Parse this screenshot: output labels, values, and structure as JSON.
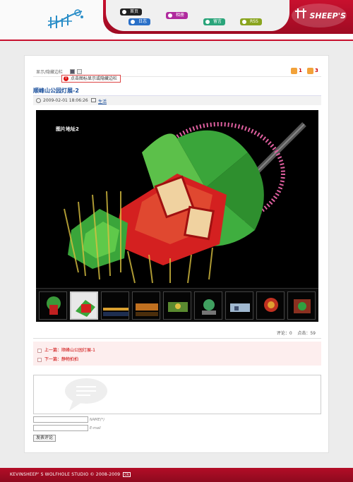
{
  "header": {
    "brand": "SHEEP'S",
    "nav": [
      {
        "label": "首页"
      },
      {
        "label": "日志"
      },
      {
        "label": "相册"
      },
      {
        "label": "留言"
      },
      {
        "label": "RSS"
      }
    ]
  },
  "toolbar": {
    "toggle_label": "显示/隐藏边栏",
    "tooltip": "点击图标显示或隐藏边栏",
    "stat1": "1",
    "stat2": "3"
  },
  "post": {
    "title": "顺峰山公园灯展-2",
    "datetime": "2009-02-01 18:06:26",
    "category": "生活",
    "photo_caption": "图片地址2",
    "thumbnail_count": 9,
    "comments_label": "评论：0",
    "views_label": "点击：59"
  },
  "navigation": {
    "prev": "上一篇：顺峰山公园灯展-1",
    "next": "下一篇：静物拍拍"
  },
  "form": {
    "name_label": "NAME(*)",
    "email_label": "E-mail",
    "submit_label": "发表评论"
  },
  "footer": {
    "text": "KEVINSHEEP' S WOLFHOLE STUDIO © 2008-2009",
    "badge": "CN"
  },
  "colors": {
    "brand_red": "#c8102e",
    "link_blue": "#1a4f9c"
  }
}
